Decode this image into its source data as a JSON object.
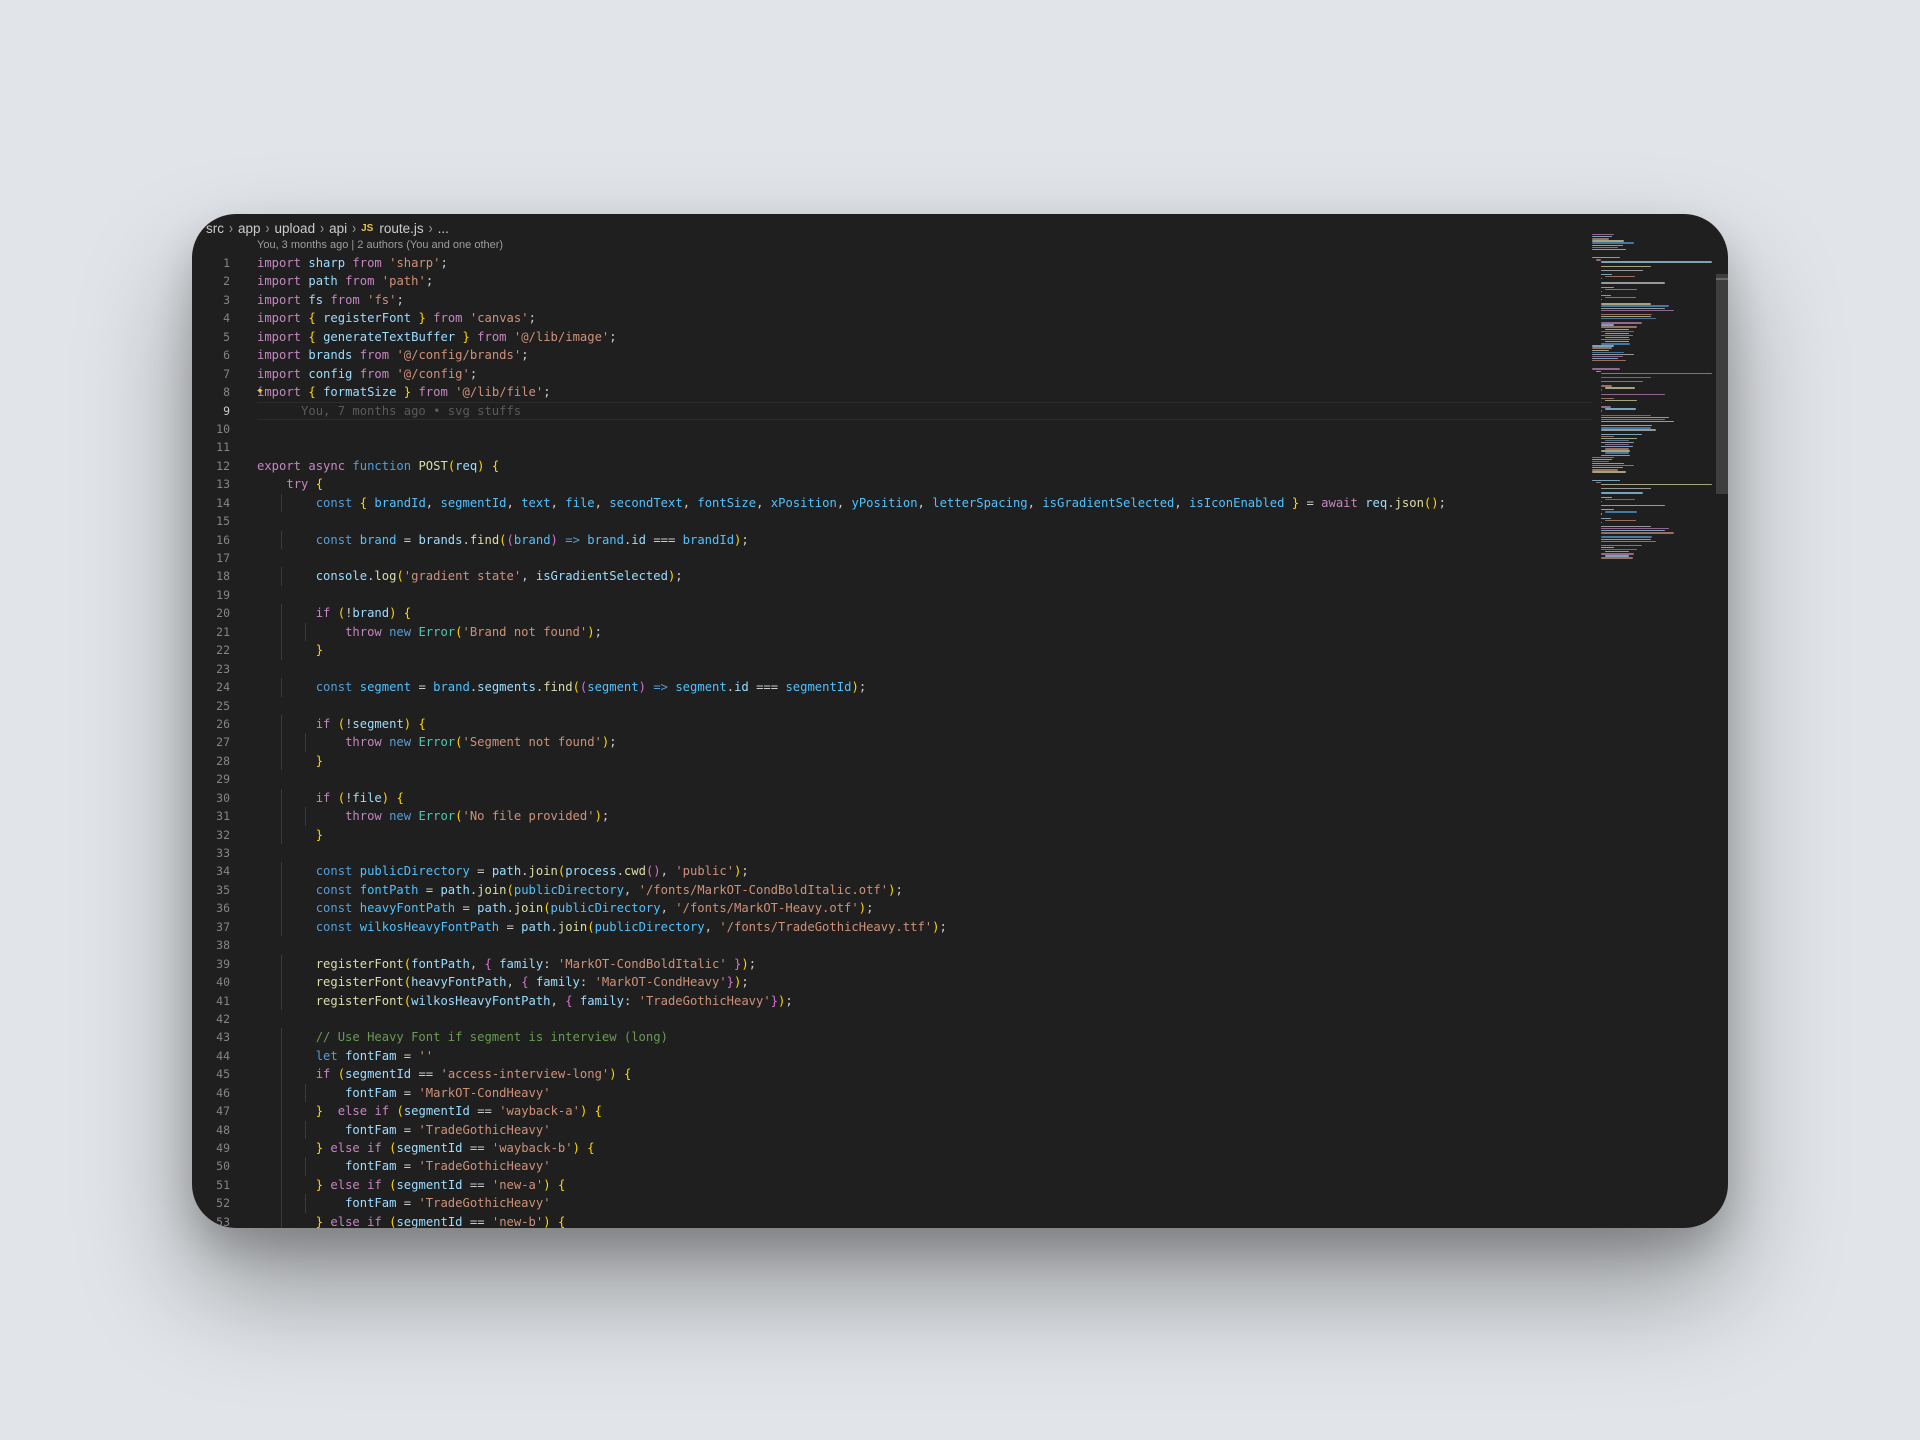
{
  "breadcrumb": {
    "items": [
      "src",
      "app",
      "upload",
      "api"
    ],
    "file_badge": "JS",
    "file_name": "route.js",
    "more": "..."
  },
  "blame_header": "You, 3 months ago | 2 authors (You and one other)",
  "inline_blame": "You, 7 months ago • svg stuffs",
  "active_line": 9,
  "colors": {
    "background": "#1f1f1f",
    "keyword": "#c586c0",
    "string": "#ce9178",
    "storage": "#569cd6",
    "function": "#dcdcaa",
    "variable": "#9cdcfe",
    "constant": "#4fc1ff",
    "class": "#4ec9b0",
    "comment": "#6a9955",
    "bracket": "#ffd700"
  },
  "icons": [
    "chevron-right-icon",
    "js-file-icon",
    "sparkle-icon"
  ],
  "code_lines": [
    "import sharp from 'sharp';",
    "import path from 'path';",
    "import fs from 'fs';",
    "import { registerFont } from 'canvas';",
    "import { generateTextBuffer } from '@/lib/image';",
    "import brands from '@/config/brands';",
    "import config from '@/config';",
    "import { formatSize } from '@/lib/file';",
    "",
    "",
    "",
    "export async function POST(req) {",
    "    try {",
    "        const { brandId, segmentId, text, file, secondText, fontSize, xPosition, yPosition, letterSpacing, isGradientSelected, isIconEnabled } = await req.json();",
    "",
    "        const brand = brands.find((brand) => brand.id === brandId);",
    "",
    "        console.log('gradient state', isGradientSelected);",
    "",
    "        if (!brand) {",
    "            throw new Error('Brand not found');",
    "        }",
    "",
    "        const segment = brand.segments.find((segment) => segment.id === segmentId);",
    "",
    "        if (!segment) {",
    "            throw new Error('Segment not found');",
    "        }",
    "",
    "        if (!file) {",
    "            throw new Error('No file provided');",
    "        }",
    "",
    "        const publicDirectory = path.join(process.cwd(), 'public');",
    "        const fontPath = path.join(publicDirectory, '/fonts/MarkOT-CondBoldItalic.otf');",
    "        const heavyFontPath = path.join(publicDirectory, '/fonts/MarkOT-Heavy.otf');",
    "        const wilkosHeavyFontPath = path.join(publicDirectory, '/fonts/TradeGothicHeavy.ttf');",
    "",
    "        registerFont(fontPath, { family: 'MarkOT-CondBoldItalic' });",
    "        registerFont(heavyFontPath, { family: 'MarkOT-CondHeavy'});",
    "        registerFont(wilkosHeavyFontPath, { family: 'TradeGothicHeavy'});",
    "",
    "        // Use Heavy Font if segment is interview (long)",
    "        let fontFam = ''",
    "        if (segmentId == 'access-interview-long') {",
    "            fontFam = 'MarkOT-CondHeavy'",
    "        }  else if (segmentId == 'wayback-a') {",
    "            fontFam = 'TradeGothicHeavy'",
    "        } else if (segmentId == 'wayback-b') {",
    "            fontFam = 'TradeGothicHeavy'",
    "        } else if (segmentId == 'new-a') {",
    "            fontFam = 'TradeGothicHeavy'",
    "        } else if (segmentId == 'new-b') {"
  ]
}
